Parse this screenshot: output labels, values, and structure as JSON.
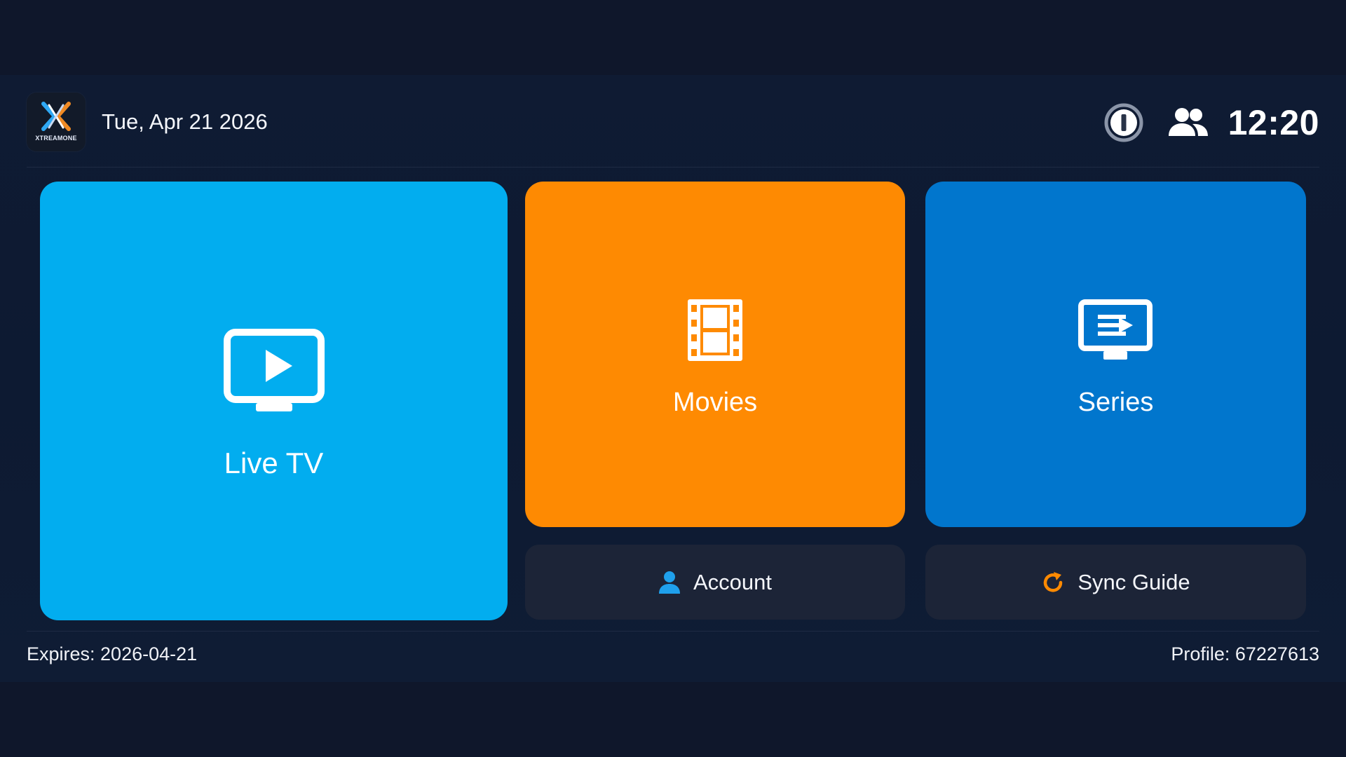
{
  "header": {
    "logo_text": "XTREAMONE",
    "date": "Tue, Apr 21 2026",
    "clock": "12:20"
  },
  "tiles": {
    "live_tv": {
      "label": "Live TV",
      "color": "#02adef"
    },
    "movies": {
      "label": "Movies",
      "color": "#fe8a02"
    },
    "series": {
      "label": "Series",
      "color": "#0176cd"
    }
  },
  "actions": {
    "account": {
      "label": "Account",
      "icon": "user-icon",
      "icon_color": "#1fa0ec"
    },
    "sync_guide": {
      "label": "Sync Guide",
      "icon": "refresh-icon",
      "icon_color": "#fe8a02"
    }
  },
  "footer": {
    "expires": "Expires: 2026-04-21",
    "profile": "Profile: 67227613"
  },
  "colors": {
    "background": "#0f172b",
    "card_dark": "#1c2437"
  }
}
